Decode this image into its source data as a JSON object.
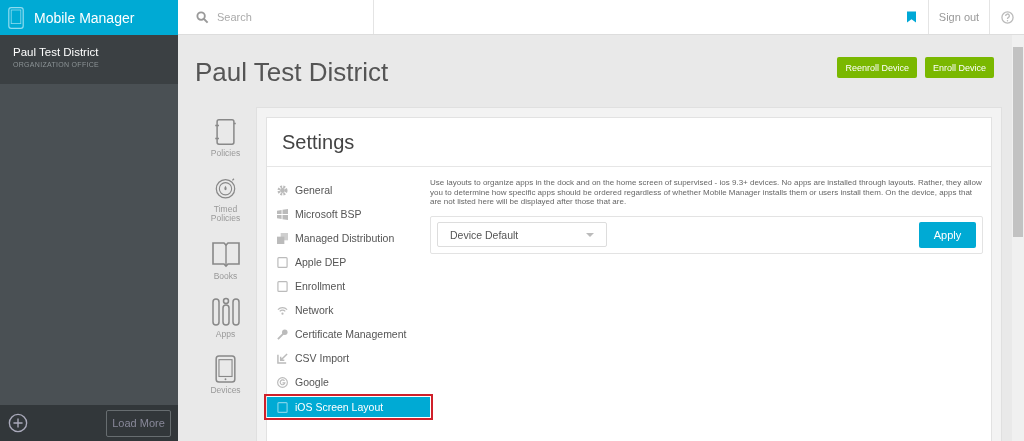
{
  "app": {
    "title": "Mobile Manager"
  },
  "search": {
    "placeholder": "Search"
  },
  "header_actions": {
    "sign_out": "Sign out"
  },
  "sidebar": {
    "items": [
      {
        "name": "Paul Test District",
        "subtitle": "ORGANIZATION OFFICE"
      }
    ],
    "load_more": "Load More"
  },
  "page": {
    "title": "Paul Test District",
    "buttons": [
      "Reenroll Device",
      "Enroll Device"
    ]
  },
  "rail": [
    {
      "label": "Policies"
    },
    {
      "label": "Timed Policies"
    },
    {
      "label": "Books"
    },
    {
      "label": "Apps"
    },
    {
      "label": "Devices"
    }
  ],
  "settings": {
    "title": "Settings",
    "items": [
      {
        "label": "General",
        "selected": false
      },
      {
        "label": "Microsoft BSP",
        "selected": false
      },
      {
        "label": "Managed Distribution",
        "selected": false
      },
      {
        "label": "Apple DEP",
        "selected": false
      },
      {
        "label": "Enrollment",
        "selected": false
      },
      {
        "label": "Network",
        "selected": false
      },
      {
        "label": "Certificate Management",
        "selected": false
      },
      {
        "label": "CSV Import",
        "selected": false
      },
      {
        "label": "Google",
        "selected": false
      },
      {
        "label": "iOS Screen Layout",
        "selected": true
      }
    ],
    "description": "Use layouts to organize apps in the dock and on the home screen of supervised - ios 9.3+ devices. No apps are installed through layouts. Rather, they allow you to determine how specific apps should be ordered regardless of whether Mobile Manager installs them or users install them. On the device, apps that are not listed here will be displayed after those that are.",
    "layout_select": {
      "value": "Device Default"
    },
    "apply": "Apply"
  }
}
